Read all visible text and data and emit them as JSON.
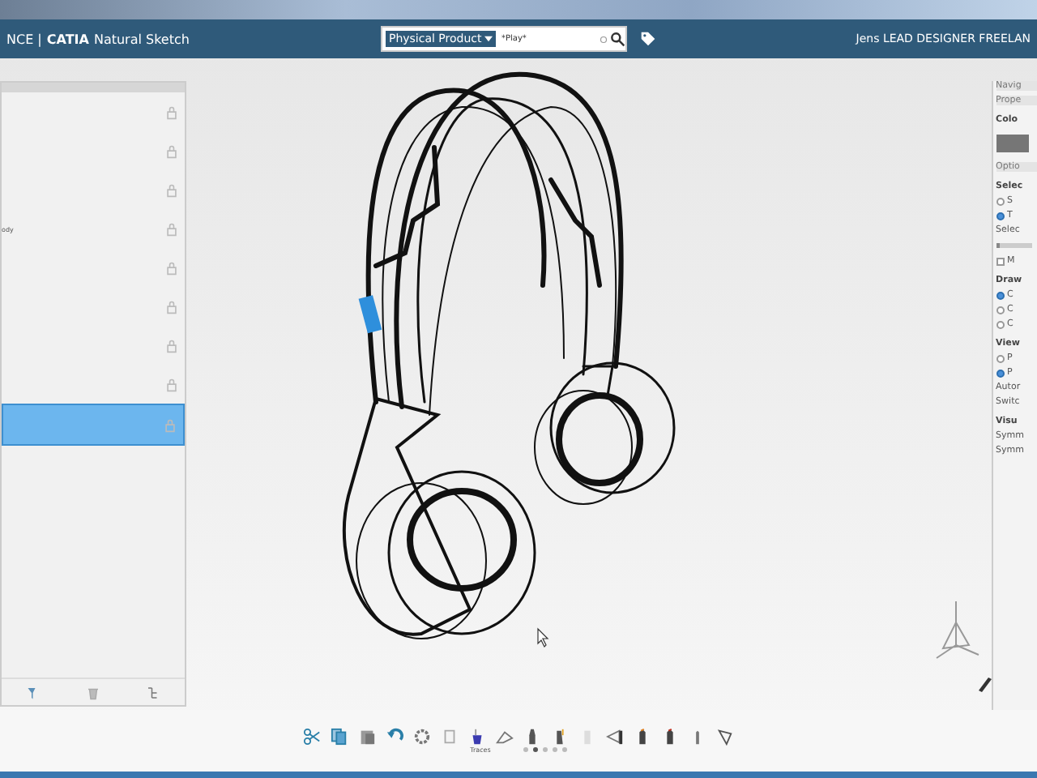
{
  "title_bar": {
    "app_prefix": "NCE |",
    "brand": "CATIA",
    "app_name": "Natural Sketch",
    "search": {
      "scope": "Physical Product",
      "value": "*Play*"
    },
    "user": "Jens LEAD DESIGNER FREELAN"
  },
  "tree_panel": {
    "rows": [
      {
        "selected": false
      },
      {
        "selected": false
      },
      {
        "selected": false
      },
      {
        "label": "ody",
        "selected": false
      },
      {
        "selected": false
      },
      {
        "selected": false
      },
      {
        "selected": false
      },
      {
        "selected": false
      },
      {
        "selected": true
      }
    ]
  },
  "right_panel": {
    "items": [
      {
        "kind": "header",
        "label": "Navig"
      },
      {
        "kind": "header",
        "label": "Prope"
      },
      {
        "kind": "subheader",
        "label": "Colo"
      },
      {
        "kind": "swatch"
      },
      {
        "kind": "header",
        "label": "Optio"
      },
      {
        "kind": "subheader",
        "label": "Selec"
      },
      {
        "kind": "radio",
        "label": "S",
        "selected": false
      },
      {
        "kind": "radio",
        "label": "T",
        "selected": true
      },
      {
        "kind": "text",
        "label": "Selec"
      },
      {
        "kind": "slider",
        "level": 0.1
      },
      {
        "kind": "checkbox",
        "label": "M",
        "checked": false
      },
      {
        "kind": "subheader",
        "label": "Draw"
      },
      {
        "kind": "radio",
        "label": "C",
        "selected": true
      },
      {
        "kind": "radio",
        "label": "C",
        "selected": false
      },
      {
        "kind": "radio",
        "label": "C",
        "selected": false
      },
      {
        "kind": "subheader",
        "label": "View"
      },
      {
        "kind": "radio",
        "label": "P",
        "selected": false
      },
      {
        "kind": "radio",
        "label": "P",
        "selected": true
      },
      {
        "kind": "text",
        "label": "Autor"
      },
      {
        "kind": "text",
        "label": "Switc"
      },
      {
        "kind": "subheader",
        "label": "Visu"
      },
      {
        "kind": "text",
        "label": "Symm"
      },
      {
        "kind": "text",
        "label": "Symm"
      }
    ]
  },
  "toolbar": {
    "label": "Traces",
    "pages": [
      {
        "selected": false
      },
      {
        "selected": true
      },
      {
        "selected": false
      },
      {
        "selected": false
      },
      {
        "selected": false
      }
    ]
  }
}
